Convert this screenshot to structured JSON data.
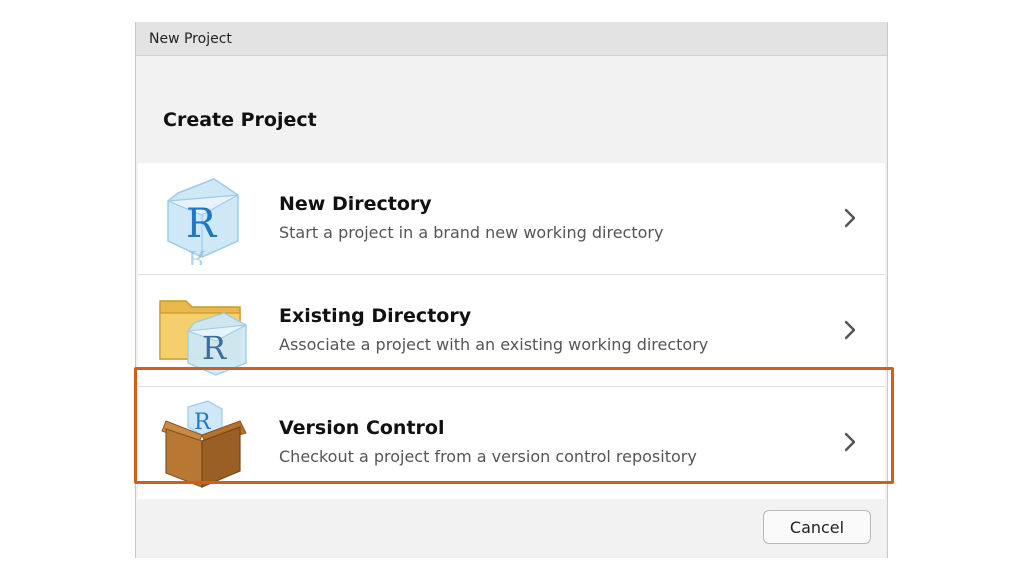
{
  "window": {
    "title": "New Project"
  },
  "heading": "Create Project",
  "options": [
    {
      "title": "New Directory",
      "description": "Start a project in a brand new working directory",
      "icon": "r-cube-icon"
    },
    {
      "title": "Existing Directory",
      "description": "Associate a project with an existing working directory",
      "icon": "folder-r-icon"
    },
    {
      "title": "Version Control",
      "description": "Checkout a project from a version control repository",
      "icon": "box-r-icon"
    }
  ],
  "buttons": {
    "cancel": "Cancel"
  },
  "colors": {
    "highlight": "#d35d1e",
    "r_blue": "#1f78c1",
    "folder": "#e8b84a",
    "box": "#b5722c"
  }
}
